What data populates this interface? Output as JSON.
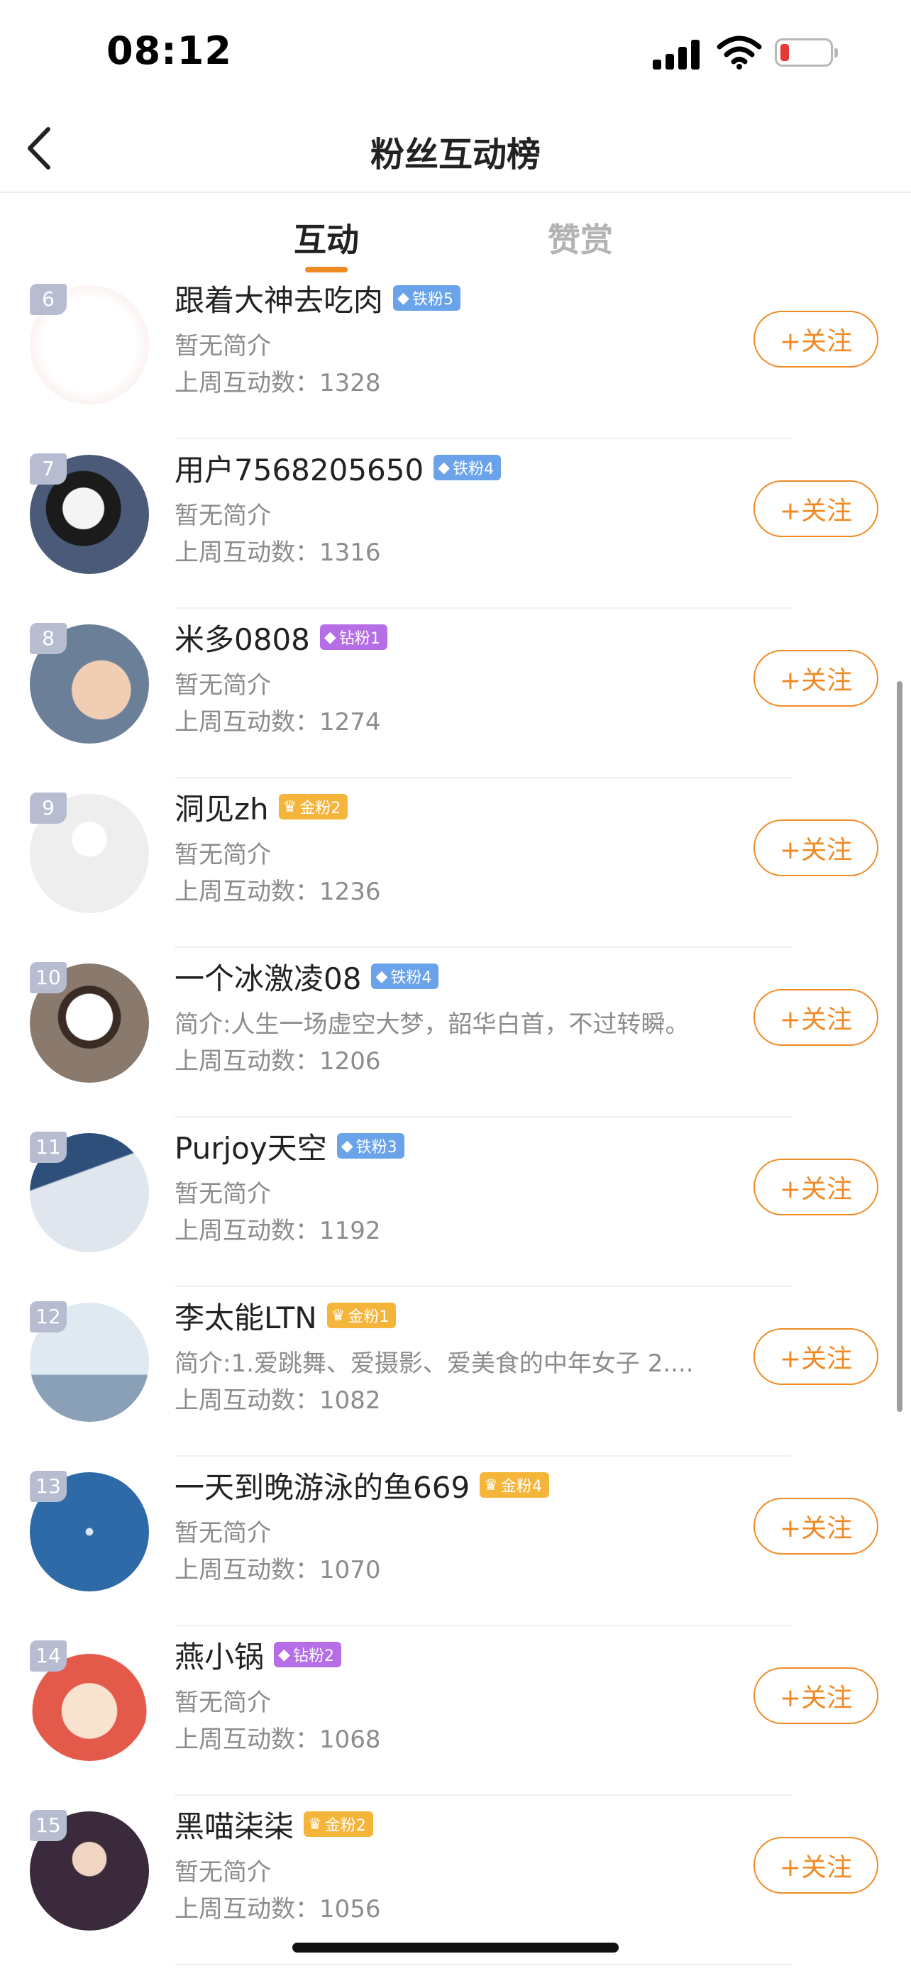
{
  "status_bar": {
    "time": "08:12",
    "signal_icon": "cellular-signal-icon",
    "wifi_icon": "wifi-icon",
    "battery_icon": "battery-low-icon"
  },
  "nav": {
    "title": "粉丝互动榜",
    "back_icon": "chevron-left-icon"
  },
  "tabs": [
    {
      "label": "互动",
      "active": true
    },
    {
      "label": "赞赏",
      "active": false
    }
  ],
  "follow_label": "+关注",
  "colors": {
    "accent": "#f08a24",
    "iron_badge": "#6aa3e9",
    "diamond_badge": "#b56ee6",
    "gold_badge": "#f5b53a",
    "rank_badge": "#b7bdd1"
  },
  "fans": [
    {
      "rank": "6",
      "name": "跟着大神去吃肉",
      "badge": "铁粉5",
      "badge_type": "iron",
      "intro": "暂无简介",
      "count": "上周互动数：1328"
    },
    {
      "rank": "7",
      "name": "用户7568205650",
      "badge": "铁粉4",
      "badge_type": "iron",
      "intro": "暂无简介",
      "count": "上周互动数：1316"
    },
    {
      "rank": "8",
      "name": "米多0808",
      "badge": "钻粉1",
      "badge_type": "diamond",
      "intro": "暂无简介",
      "count": "上周互动数：1274"
    },
    {
      "rank": "9",
      "name": "洞见zh",
      "badge": "金粉2",
      "badge_type": "gold",
      "intro": "暂无简介",
      "count": "上周互动数：1236"
    },
    {
      "rank": "10",
      "name": "一个冰激凌08",
      "badge": "铁粉4",
      "badge_type": "iron",
      "intro": "简介:人生一场虚空大梦，韶华白首，不过转瞬。",
      "count": "上周互动数：1206"
    },
    {
      "rank": "11",
      "name": "Purjoy天空",
      "badge": "铁粉3",
      "badge_type": "iron",
      "intro": "暂无简介",
      "count": "上周互动数：1192"
    },
    {
      "rank": "12",
      "name": "李太能LTN",
      "badge": "金粉1",
      "badge_type": "gold",
      "intro": "简介:1.爱跳舞、爱摄影、爱美食的中年女子 2....",
      "count": "上周互动数：1082"
    },
    {
      "rank": "13",
      "name": "一天到晚游泳的鱼669",
      "badge": "金粉4",
      "badge_type": "gold",
      "intro": "暂无简介",
      "count": "上周互动数：1070"
    },
    {
      "rank": "14",
      "name": "燕小锅",
      "badge": "钻粉2",
      "badge_type": "diamond",
      "intro": "暂无简介",
      "count": "上周互动数：1068"
    },
    {
      "rank": "15",
      "name": "黑喵柒柒",
      "badge": "金粉2",
      "badge_type": "gold",
      "intro": "暂无简介",
      "count": "上周互动数：1056"
    }
  ]
}
